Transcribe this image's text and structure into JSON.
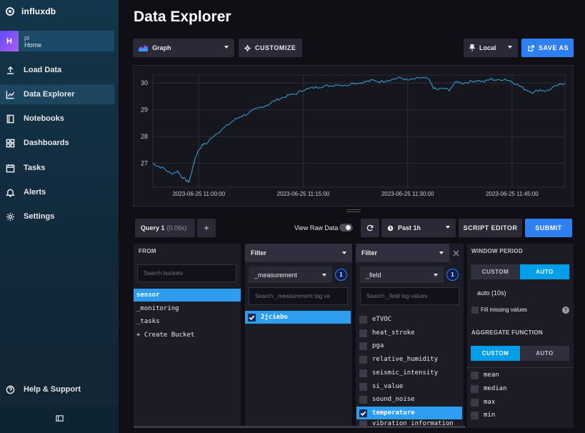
{
  "app": {
    "logo_text": "influxdb"
  },
  "org": {
    "avatar_letter": "H",
    "user": "pi",
    "home": "Home"
  },
  "nav": {
    "items": [
      {
        "label": "Load Data",
        "icon": "upload-icon"
      },
      {
        "label": "Data Explorer",
        "icon": "graph-icon",
        "active": true
      },
      {
        "label": "Notebooks",
        "icon": "notebook-icon"
      },
      {
        "label": "Dashboards",
        "icon": "dashboard-icon"
      },
      {
        "label": "Tasks",
        "icon": "calendar-icon"
      },
      {
        "label": "Alerts",
        "icon": "bell-icon"
      },
      {
        "label": "Settings",
        "icon": "gear-icon"
      }
    ],
    "help": {
      "label": "Help & Support",
      "icon": "question-icon"
    }
  },
  "page": {
    "title": "Data Explorer"
  },
  "toolbar": {
    "graph_type": "Graph",
    "customize": "CUSTOMIZE",
    "timezone": "Local",
    "save_as": "SAVE AS"
  },
  "chart_data": {
    "type": "line",
    "x_tick_labels": [
      "2023-06-25 11:00:00",
      "2023-06-25 11:15:00",
      "2023-06-25 11:30:00",
      "2023-06-25 11:45:00"
    ],
    "y_tick_labels": [
      "27",
      "28",
      "29",
      "30"
    ],
    "ylim": [
      26.1,
      30.3
    ],
    "xlim_minutes": [
      -6.6,
      52.6
    ],
    "grid": true,
    "series": [
      {
        "color": "#35a8d8",
        "points": [
          [
            -6.6,
            27.0
          ],
          [
            -6.0,
            26.9
          ],
          [
            -5.0,
            26.8
          ],
          [
            -4.0,
            26.6
          ],
          [
            -3.0,
            26.7
          ],
          [
            -2.5,
            26.5
          ],
          [
            -1.8,
            26.35
          ],
          [
            -1.4,
            26.3
          ],
          [
            -1.0,
            26.7
          ],
          [
            -0.5,
            27.2
          ],
          [
            0.0,
            27.5
          ],
          [
            0.6,
            27.7
          ],
          [
            1.2,
            27.75
          ],
          [
            2.0,
            28.0
          ],
          [
            3.0,
            28.2
          ],
          [
            4.0,
            28.4
          ],
          [
            5.0,
            28.6
          ],
          [
            6.0,
            28.75
          ],
          [
            7.0,
            28.85
          ],
          [
            8.0,
            29.0
          ],
          [
            9.0,
            29.1
          ],
          [
            10.0,
            29.2
          ],
          [
            11.0,
            29.35
          ],
          [
            12.0,
            29.45
          ],
          [
            13.0,
            29.55
          ],
          [
            14.0,
            29.6
          ],
          [
            15.0,
            29.75
          ],
          [
            16.0,
            29.8
          ],
          [
            17.0,
            29.85
          ],
          [
            18.0,
            29.88
          ],
          [
            19.0,
            29.9
          ],
          [
            20.0,
            29.95
          ],
          [
            21.0,
            29.9
          ],
          [
            22.0,
            30.0
          ],
          [
            23.0,
            30.0
          ],
          [
            24.0,
            30.05
          ],
          [
            25.0,
            30.1
          ],
          [
            26.0,
            30.05
          ],
          [
            27.0,
            30.1
          ],
          [
            28.0,
            30.15
          ],
          [
            29.0,
            30.2
          ],
          [
            30.0,
            30.1
          ],
          [
            31.0,
            30.15
          ],
          [
            32.0,
            30.2
          ],
          [
            33.0,
            30.15
          ],
          [
            33.6,
            29.85
          ],
          [
            34.2,
            29.75
          ],
          [
            35.0,
            29.8
          ],
          [
            36.0,
            29.75
          ],
          [
            37.0,
            30.05
          ],
          [
            38.0,
            30.0
          ],
          [
            39.0,
            30.05
          ],
          [
            40.0,
            30.1
          ],
          [
            41.0,
            30.05
          ],
          [
            42.0,
            30.15
          ],
          [
            43.0,
            30.1
          ],
          [
            44.0,
            30.15
          ],
          [
            45.0,
            30.05
          ],
          [
            46.0,
            29.9
          ],
          [
            47.0,
            29.75
          ],
          [
            48.0,
            29.65
          ],
          [
            49.0,
            29.75
          ],
          [
            50.0,
            29.7
          ],
          [
            51.0,
            29.85
          ],
          [
            52.0,
            29.95
          ],
          [
            52.6,
            30.0
          ]
        ]
      }
    ]
  },
  "query": {
    "tab_label": "Query 1",
    "tab_time": "(0.06s)",
    "add_tab": "+",
    "view_raw_data": "View Raw Data",
    "time_range": "Past 1h",
    "script_editor": "SCRIPT EDITOR",
    "submit": "SUBMIT"
  },
  "from": {
    "header": "FROM",
    "search_placeholder": "Search buckets",
    "buckets": [
      "sensor",
      "_monitoring",
      "_tasks",
      "+ Create Bucket"
    ],
    "selected": "sensor"
  },
  "filter1": {
    "header": "Filter",
    "key": "_measurement",
    "count": "1",
    "search_placeholder": "Search _measurement tag va",
    "values": [
      {
        "label": "2jciebu",
        "checked": true
      }
    ]
  },
  "filter2": {
    "header": "Filter",
    "key": "_field",
    "count": "1",
    "search_placeholder": "Search _field tag values",
    "values": [
      {
        "label": "eTVOC",
        "checked": false
      },
      {
        "label": "heat_stroke",
        "checked": false
      },
      {
        "label": "pga",
        "checked": false
      },
      {
        "label": "relative_humidity",
        "checked": false
      },
      {
        "label": "seismic_intensity",
        "checked": false
      },
      {
        "label": "si_value",
        "checked": false
      },
      {
        "label": "sound_noise",
        "checked": false
      },
      {
        "label": "temperature",
        "checked": true
      },
      {
        "label": "vibration_information",
        "checked": false
      }
    ]
  },
  "window_period": {
    "header": "WINDOW PERIOD",
    "custom": "CUSTOM",
    "auto": "AUTO",
    "value": "auto (10s)",
    "fill_missing": "Fill missing values"
  },
  "aggregate": {
    "header": "AGGREGATE FUNCTION",
    "custom": "CUSTOM",
    "auto": "AUTO",
    "functions": [
      "mean",
      "median",
      "max",
      "min"
    ]
  }
}
